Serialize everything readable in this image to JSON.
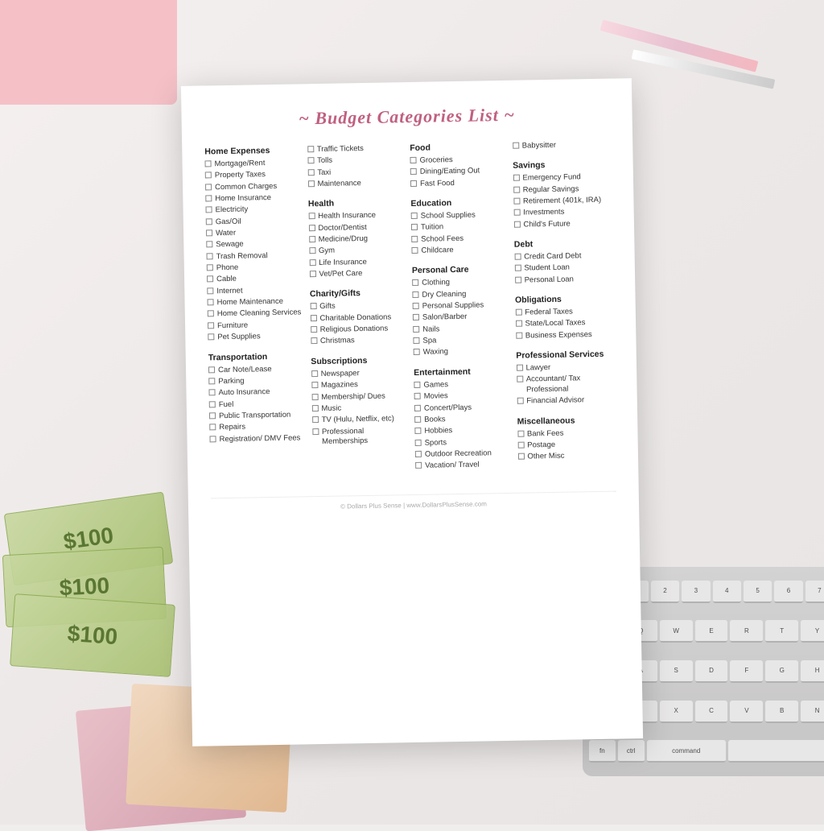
{
  "title": "~ Budget Categories List ~",
  "columns": [
    {
      "sections": [
        {
          "title": "Home Expenses",
          "items": [
            "Mortgage/Rent",
            "Property Taxes",
            "Common Charges",
            "Home Insurance",
            "Electricity",
            "Gas/Oil",
            "Water",
            "Sewage",
            "Trash Removal",
            "Phone",
            "Cable",
            "Internet",
            "Home Maintenance",
            "Home Cleaning Services",
            "Furniture",
            "Pet Supplies"
          ]
        },
        {
          "title": "Transportation",
          "items": [
            "Car Note/Lease",
            "Parking",
            "Auto Insurance",
            "Fuel",
            "Public Transportation",
            "Repairs",
            "Registration/ DMV Fees"
          ]
        }
      ]
    },
    {
      "sections": [
        {
          "title": "",
          "items": [
            "Traffic Tickets",
            "Tolls",
            "Taxi",
            "Maintenance"
          ]
        },
        {
          "title": "Health",
          "items": [
            "Health Insurance",
            "Doctor/Dentist",
            "Medicine/Drug",
            "Gym",
            "Life Insurance",
            "Vet/Pet Care"
          ]
        },
        {
          "title": "Charity/Gifts",
          "items": [
            "Gifts",
            "Charitable Donations",
            "Religious Donations",
            "Christmas"
          ]
        },
        {
          "title": "Subscriptions",
          "items": [
            "Newspaper",
            "Magazines",
            "Membership/ Dues",
            "Music",
            "TV (Hulu, Netflix, etc)",
            "Professional Memberships"
          ]
        }
      ]
    },
    {
      "sections": [
        {
          "title": "Food",
          "items": [
            "Groceries",
            "Dining/Eating Out",
            "Fast Food"
          ]
        },
        {
          "title": "Education",
          "items": [
            "School Supplies",
            "Tuition",
            "School Fees",
            "Childcare"
          ]
        },
        {
          "title": "Personal Care",
          "items": [
            "Clothing",
            "Dry Cleaning",
            "Personal Supplies",
            "Salon/Barber",
            "Nails",
            "Spa",
            "Waxing"
          ]
        },
        {
          "title": "Entertainment",
          "items": [
            "Games",
            "Movies",
            "Concert/Plays",
            "Books",
            "Hobbies",
            "Sports",
            "Outdoor Recreation",
            "Vacation/ Travel"
          ]
        }
      ]
    },
    {
      "sections": [
        {
          "title": "",
          "items": [
            "Babysitter"
          ]
        },
        {
          "title": "Savings",
          "items": [
            "Emergency Fund",
            "Regular Savings",
            "Retirement (401k, IRA)",
            "Investments",
            "Child's Future"
          ]
        },
        {
          "title": "Debt",
          "items": [
            "Credit Card Debt",
            "Student Loan",
            "Personal Loan"
          ]
        },
        {
          "title": "Obligations",
          "items": [
            "Federal Taxes",
            "State/Local Taxes",
            "Business Expenses"
          ]
        },
        {
          "title": "Professional Services",
          "items": [
            "Lawyer",
            "Accountant/ Tax Professional",
            "Financial Advisor"
          ]
        },
        {
          "title": "Miscellaneous",
          "items": [
            "Bank Fees",
            "Postage",
            "Other Misc"
          ]
        }
      ]
    }
  ],
  "footer": "© Dollars Plus Sense | www.DollarsPlusSense.com"
}
